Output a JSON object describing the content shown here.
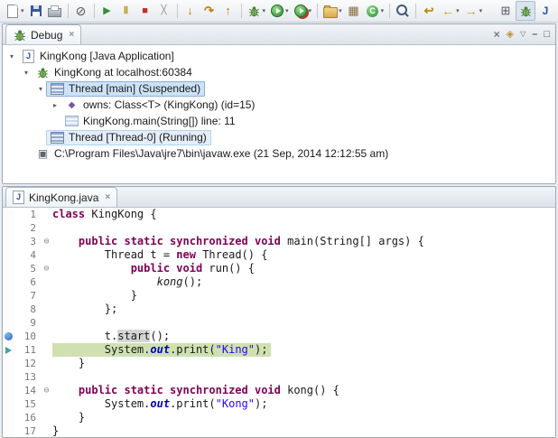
{
  "toolbar": {
    "items": [
      {
        "name": "new-wizard-icon",
        "dropdown": true
      },
      {
        "name": "save-icon"
      },
      {
        "name": "print-icon"
      },
      {
        "sep": true
      },
      {
        "name": "skip-breakpoints-icon"
      },
      {
        "sep": true
      },
      {
        "name": "resume-icon"
      },
      {
        "name": "suspend-icon"
      },
      {
        "name": "terminate-icon"
      },
      {
        "name": "disconnect-icon"
      },
      {
        "sep": true
      },
      {
        "name": "step-into-icon"
      },
      {
        "name": "step-over-icon"
      },
      {
        "name": "step-return-icon"
      },
      {
        "sep": true
      },
      {
        "name": "debug-icon",
        "dropdown": true
      },
      {
        "name": "run-icon",
        "dropdown": true
      },
      {
        "name": "external-tools-icon",
        "dropdown": true
      },
      {
        "sep": true
      },
      {
        "name": "new-java-project-icon",
        "dropdown": true
      },
      {
        "name": "new-package-icon"
      },
      {
        "name": "new-class-icon",
        "dropdown": true
      },
      {
        "sep": true
      },
      {
        "name": "search-icon"
      },
      {
        "sep": true
      },
      {
        "name": "last-edit-location-icon"
      },
      {
        "name": "back-icon",
        "dropdown": true
      },
      {
        "name": "forward-icon",
        "dropdown": true
      },
      {
        "spacer": true
      },
      {
        "name": "open-perspective-icon"
      },
      {
        "name": "perspective-debug-icon",
        "pressed": true
      },
      {
        "name": "perspective-java-icon"
      }
    ]
  },
  "debug_view": {
    "tab_label": "Debug",
    "header_icons": [
      {
        "name": "remove-all-terminated-icon"
      },
      {
        "name": "view-settings-icon"
      },
      {
        "name": "view-menu-icon"
      },
      {
        "name": "minimize-icon"
      },
      {
        "name": "maximize-icon"
      }
    ],
    "tree": [
      {
        "label": "KingKong [Java Application]",
        "icon": "java-app",
        "indent": 0,
        "arrow": "expanded"
      },
      {
        "label": "KingKong at localhost:60384",
        "icon": "debug-target",
        "indent": 1,
        "arrow": "expanded"
      },
      {
        "label": "Thread [main] (Suspended)",
        "icon": "thread",
        "indent": 2,
        "arrow": "expanded",
        "selected": "primary"
      },
      {
        "label": "owns: Class<T> (KingKong) (id=15)",
        "icon": "monitor",
        "indent": 3,
        "arrow": "collapsed"
      },
      {
        "label": "KingKong.main(String[]) line: 11",
        "icon": "stack-frame",
        "indent": 3
      },
      {
        "label": "Thread [Thread-0] (Running)",
        "icon": "thread",
        "indent": 2,
        "selected": "secondary"
      },
      {
        "label": "C:\\Program Files\\Java\\jre7\\bin\\javaw.exe (21 Sep, 2014 12:12:55 am)",
        "icon": "process",
        "indent": 1
      }
    ]
  },
  "editor": {
    "tab_label": "KingKong.java",
    "lines": [
      {
        "n": "1",
        "tokens": [
          {
            "c": "kw",
            "t": "class"
          },
          {
            "c": "pl",
            "t": " KingKong {"
          }
        ]
      },
      {
        "n": "2",
        "tokens": []
      },
      {
        "n": "3",
        "fold": true,
        "tokens": [
          {
            "c": "pl",
            "t": "    "
          },
          {
            "c": "kw",
            "t": "public static synchronized void"
          },
          {
            "c": "pl",
            "t": " main(String[] args) {"
          }
        ]
      },
      {
        "n": "4",
        "tokens": [
          {
            "c": "pl",
            "t": "        Thread t = "
          },
          {
            "c": "kw",
            "t": "new"
          },
          {
            "c": "pl",
            "t": " Thread() {"
          }
        ]
      },
      {
        "n": "5",
        "fold": true,
        "tokens": [
          {
            "c": "pl",
            "t": "            "
          },
          {
            "c": "kw",
            "t": "public void"
          },
          {
            "c": "pl",
            "t": " run() {"
          }
        ]
      },
      {
        "n": "6",
        "tokens": [
          {
            "c": "pl",
            "t": "                "
          },
          {
            "c": "it",
            "t": "kong"
          },
          {
            "c": "pl",
            "t": "();"
          }
        ]
      },
      {
        "n": "7",
        "tokens": [
          {
            "c": "pl",
            "t": "            }"
          }
        ]
      },
      {
        "n": "8",
        "tokens": [
          {
            "c": "pl",
            "t": "        };"
          }
        ]
      },
      {
        "n": "9",
        "tokens": []
      },
      {
        "n": "10",
        "marker": "breakpoint",
        "tokens": [
          {
            "c": "pl",
            "t": "        t."
          },
          {
            "c": "occ",
            "t": "start"
          },
          {
            "c": "pl",
            "t": "();"
          }
        ]
      },
      {
        "n": "11",
        "marker": "arrow",
        "highlight": true,
        "tokens": [
          {
            "c": "pl",
            "t": "        System."
          },
          {
            "c": "sf",
            "t": "out"
          },
          {
            "c": "pl",
            "t": ".print("
          },
          {
            "c": "str",
            "t": "\"King\""
          },
          {
            "c": "pl",
            "t": ");"
          }
        ]
      },
      {
        "n": "12",
        "tokens": [
          {
            "c": "pl",
            "t": "    }"
          }
        ]
      },
      {
        "n": "13",
        "tokens": []
      },
      {
        "n": "14",
        "fold": true,
        "tokens": [
          {
            "c": "pl",
            "t": "    "
          },
          {
            "c": "kw",
            "t": "public static synchronized void"
          },
          {
            "c": "pl",
            "t": " kong() {"
          }
        ]
      },
      {
        "n": "15",
        "tokens": [
          {
            "c": "pl",
            "t": "        System."
          },
          {
            "c": "sf",
            "t": "out"
          },
          {
            "c": "pl",
            "t": ".print("
          },
          {
            "c": "str",
            "t": "\"Kong\""
          },
          {
            "c": "pl",
            "t": ");"
          }
        ]
      },
      {
        "n": "16",
        "tokens": [
          {
            "c": "pl",
            "t": "    }"
          }
        ]
      },
      {
        "n": "17",
        "tokens": [
          {
            "c": "pl",
            "t": "}"
          }
        ]
      }
    ]
  }
}
